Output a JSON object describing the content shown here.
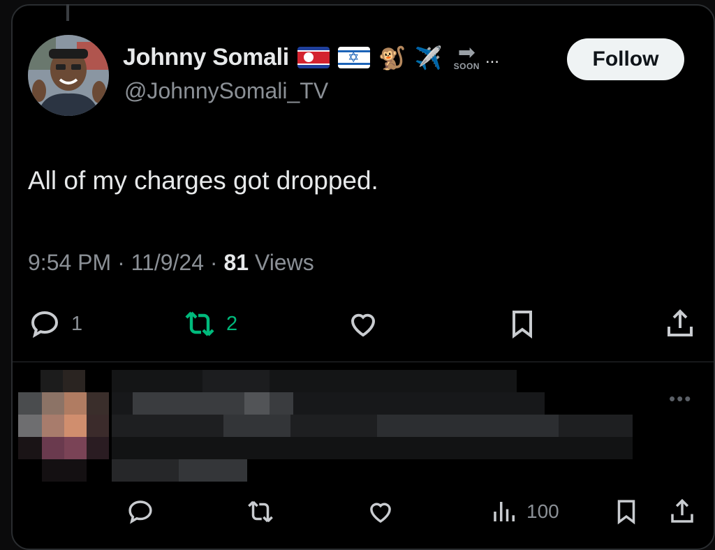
{
  "tweet": {
    "author_name": "Johnny Somali",
    "name_emojis": [
      "🐒",
      "✈️"
    ],
    "soon_label": "SOON",
    "ellipsis": "...",
    "handle": "@JohnnySomali_TV",
    "follow_label": "Follow",
    "text": "All of my charges got dropped.",
    "time": "9:54 PM",
    "date": "11/9/24",
    "views_count": "81",
    "views_label": "Views",
    "replies": "1",
    "retweets": "2"
  },
  "reply": {
    "views": "100",
    "more_label": "•••"
  },
  "colors": {
    "retweet_green": "#00ba7c",
    "muted": "#8b9096",
    "text": "#e7e9ea",
    "background": "#000000"
  },
  "icons": [
    "reply-icon",
    "retweet-icon",
    "like-icon",
    "bookmark-icon",
    "share-icon",
    "views-icon",
    "more-icon"
  ]
}
